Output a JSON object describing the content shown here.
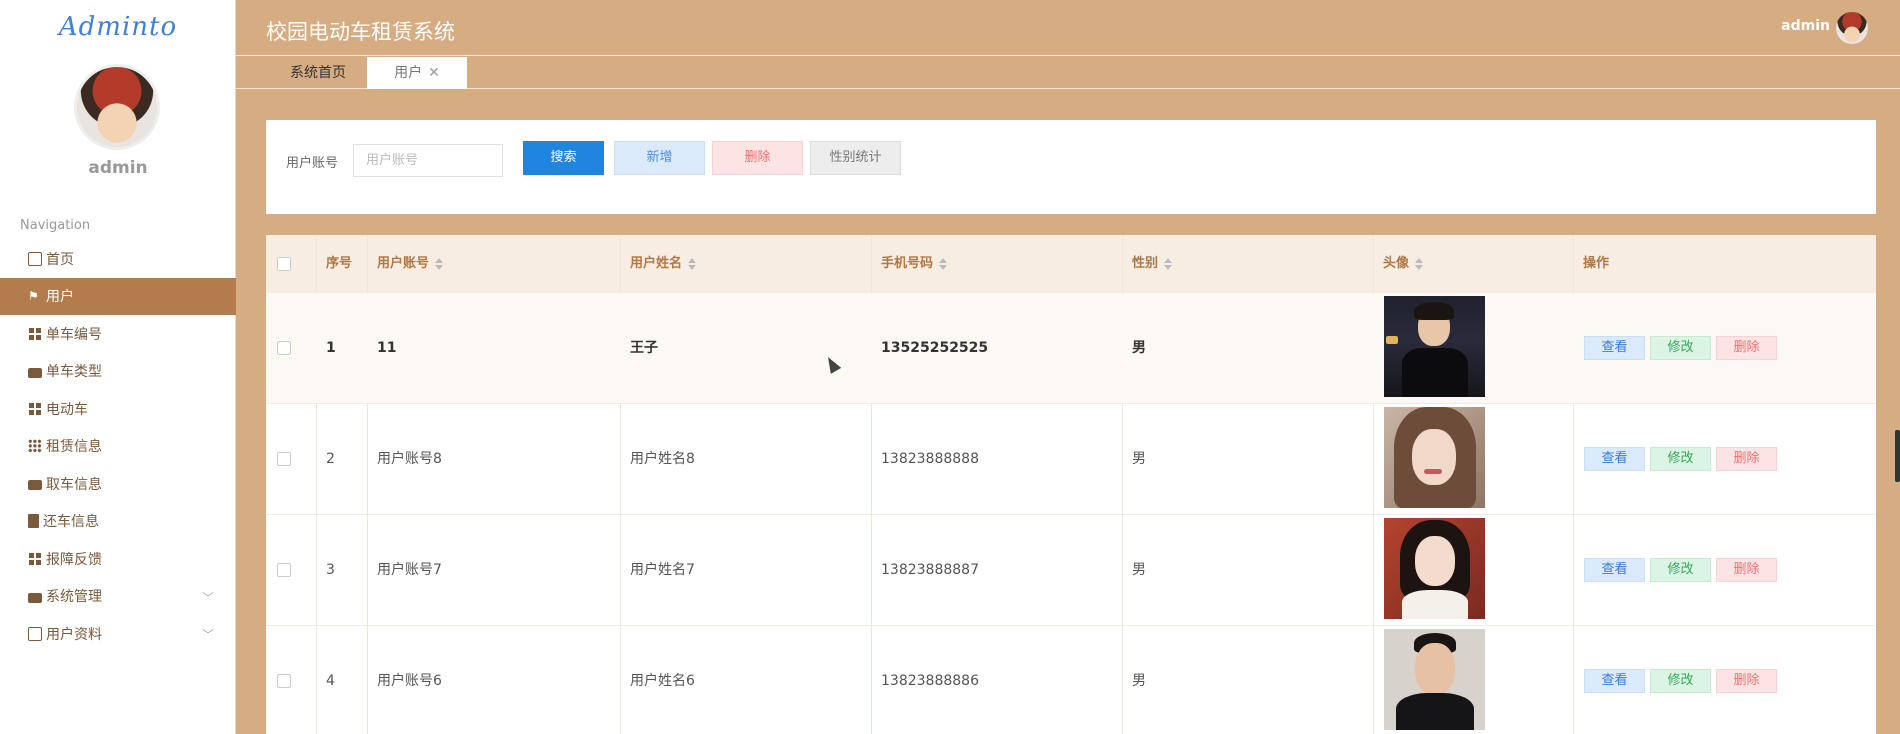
{
  "sidebar": {
    "logo": "Adminto",
    "username": "admin",
    "nav_title": "Navigation",
    "items": [
      {
        "label": "首页",
        "icon": "home-icon"
      },
      {
        "label": "用户",
        "icon": "flag-icon",
        "active": true
      },
      {
        "label": "单车编号",
        "icon": "grid-icon"
      },
      {
        "label": "单车类型",
        "icon": "briefcase-icon"
      },
      {
        "label": "电动车",
        "icon": "grid-icon"
      },
      {
        "label": "租赁信息",
        "icon": "grid9-icon"
      },
      {
        "label": "取车信息",
        "icon": "printer-icon"
      },
      {
        "label": "还车信息",
        "icon": "clipboard-icon"
      },
      {
        "label": "报障反馈",
        "icon": "grid-icon"
      },
      {
        "label": "系统管理",
        "icon": "briefcase-icon",
        "expandable": true
      },
      {
        "label": "用户资料",
        "icon": "window-icon",
        "expandable": true
      }
    ]
  },
  "header": {
    "title": "校园电动车租赁系统",
    "user": "admin"
  },
  "tabs": [
    {
      "label": "系统首页"
    },
    {
      "label": "用户",
      "closable": true,
      "active": true
    }
  ],
  "search": {
    "label": "用户账号",
    "placeholder": "用户账号",
    "search_button": "搜索",
    "add_button": "新增",
    "delete_button": "删除",
    "stats_button": "性别统计"
  },
  "table": {
    "columns": [
      "序号",
      "用户账号",
      "用户姓名",
      "手机号码",
      "性别",
      "头像",
      "操作"
    ],
    "rows": [
      {
        "index": "1",
        "account": "11",
        "name": "王子",
        "phone": "13525252525",
        "gender": "男"
      },
      {
        "index": "2",
        "account": "用户账号8",
        "name": "用户姓名8",
        "phone": "13823888888",
        "gender": "男"
      },
      {
        "index": "3",
        "account": "用户账号7",
        "name": "用户姓名7",
        "phone": "13823888887",
        "gender": "男"
      },
      {
        "index": "4",
        "account": "用户账号6",
        "name": "用户姓名6",
        "phone": "13823888886",
        "gender": "男"
      }
    ],
    "actions": {
      "view": "查看",
      "edit": "修改",
      "delete": "删除"
    }
  },
  "colors": {
    "accent": "#d6ac82",
    "active_menu": "#b37c4d",
    "primary": "#1f86e0"
  }
}
